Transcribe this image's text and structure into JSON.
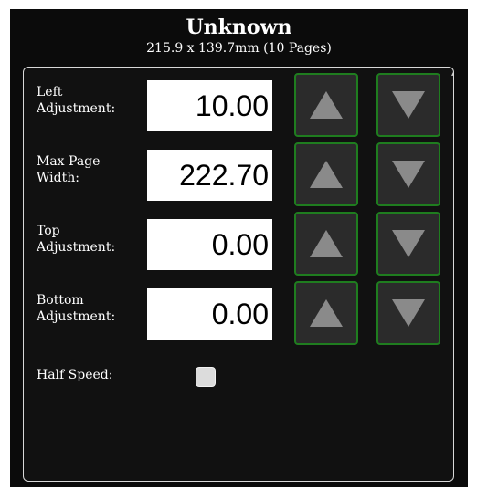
{
  "header": {
    "title": "Unknown",
    "subtitle": "215.9 x 139.7mm (10 Pages)"
  },
  "fields": [
    {
      "label": "Left\nAdjustment:",
      "value": "10.00"
    },
    {
      "label": "Max Page\nWidth:",
      "value": "222.70"
    },
    {
      "label": "Top\nAdjustment:",
      "value": "0.00"
    },
    {
      "label": "Bottom\nAdjustment:",
      "value": "0.00"
    }
  ],
  "half_speed": {
    "label": "Half Speed:",
    "checked": false
  },
  "icons": {
    "increment": "up-arrow-icon",
    "decrement": "down-arrow-icon"
  },
  "colors": {
    "background": "#0b0b0b",
    "button_border": "#1f7d1f",
    "button_fill": "#2b2b2b",
    "arrow": "#8a8a8a"
  }
}
